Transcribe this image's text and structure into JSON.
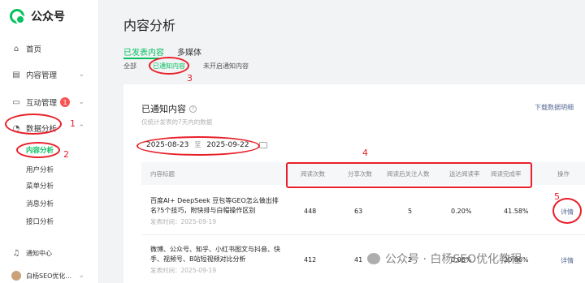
{
  "app": {
    "name": "公众号"
  },
  "sidebar": {
    "items": [
      {
        "label": "首页"
      },
      {
        "label": "内容管理"
      },
      {
        "label": "互动管理",
        "badge": "1"
      },
      {
        "label": "数据分析"
      }
    ],
    "sub_items": [
      {
        "label": "内容分析"
      },
      {
        "label": "用户分析"
      },
      {
        "label": "菜单分析"
      },
      {
        "label": "消息分析"
      },
      {
        "label": "接口分析"
      }
    ],
    "notification": "通知中心",
    "account": "白杨SEO优化..."
  },
  "page": {
    "title": "内容分析"
  },
  "tabs": [
    "已发表内容",
    "多媒体"
  ],
  "subtabs": [
    "全部",
    "已通知内容",
    "未开启通知内容"
  ],
  "card": {
    "title": "已通知内容",
    "note": "仅统计发表的7天内的数据",
    "download": "下载数据明细",
    "date_start": "2025-08-23",
    "date_sep": "至",
    "date_end": "2025-09-22"
  },
  "table": {
    "headers": [
      "内容标题",
      "阅读次数",
      "分享次数",
      "阅读后关注人数",
      "送达阅读率",
      "阅读完成率",
      "操作"
    ],
    "rows": [
      {
        "title": "百度AI+ DeepSeek 豆包等GEO怎么做出排名?5个技巧，附快排与白帽操作区别",
        "time": "发表时间：2025-09-19",
        "reads": "448",
        "shares": "63",
        "follows": "5",
        "delivery_rate": "0.20%",
        "completion_rate": "41.58%",
        "action": "详情"
      },
      {
        "title": "微博、公众号、知乎、小红书图文与抖音、快手、视频号、B站短视频对比分析",
        "time": "发表时间：2025-09-19",
        "reads": "412",
        "shares": "41",
        "follows": "2",
        "delivery_rate": "0.06%",
        "completion_rate": "20.86%",
        "action": "详情"
      }
    ]
  },
  "annotations": [
    "1",
    "2",
    "3",
    "4",
    "5"
  ],
  "watermark": "公众号 · 白杨SEO优化教程",
  "colors": {
    "accent": "#07c160",
    "annotation": "#e8202a",
    "link": "#576b95"
  }
}
